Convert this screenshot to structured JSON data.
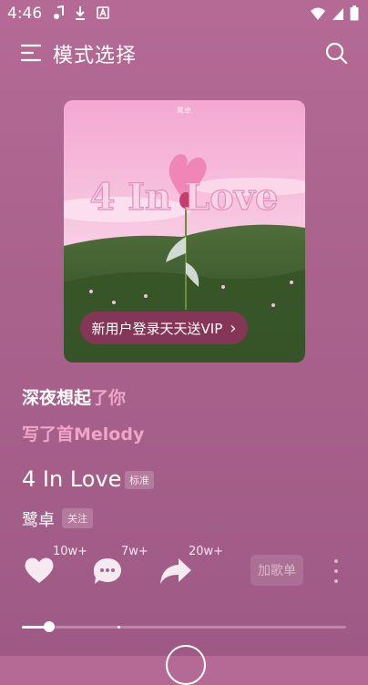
{
  "status": {
    "time": "4:46"
  },
  "header": {
    "title": "模式选择"
  },
  "album": {
    "art_title": "4 In Love",
    "vip_promo": "新用户登录天天送VIP",
    "chevron": "›"
  },
  "lyrics": {
    "line1_highlight": "深夜想起",
    "line1_rest": "了你",
    "line2": "写了首Melody"
  },
  "song": {
    "title": "4 In Love",
    "quality": "标准",
    "artist": "鹭卓",
    "follow": "关注"
  },
  "actions": {
    "likes": "10w+",
    "comments": "7w+",
    "shares": "20w+",
    "add_playlist": "加歌单"
  },
  "progress": {
    "fraction": 0.085,
    "buffered": 0.295
  },
  "colors": {
    "background": "#a9628c",
    "pill": "#8c345a",
    "accent_pink": "#f0a5c8"
  },
  "icons": [
    "music-note-icon",
    "download-icon",
    "a-icon",
    "wifi-icon",
    "signal-icon",
    "battery-icon",
    "menu-icon",
    "search-icon",
    "heart-icon",
    "comment-icon",
    "share-icon",
    "more-icon",
    "play-icon"
  ]
}
